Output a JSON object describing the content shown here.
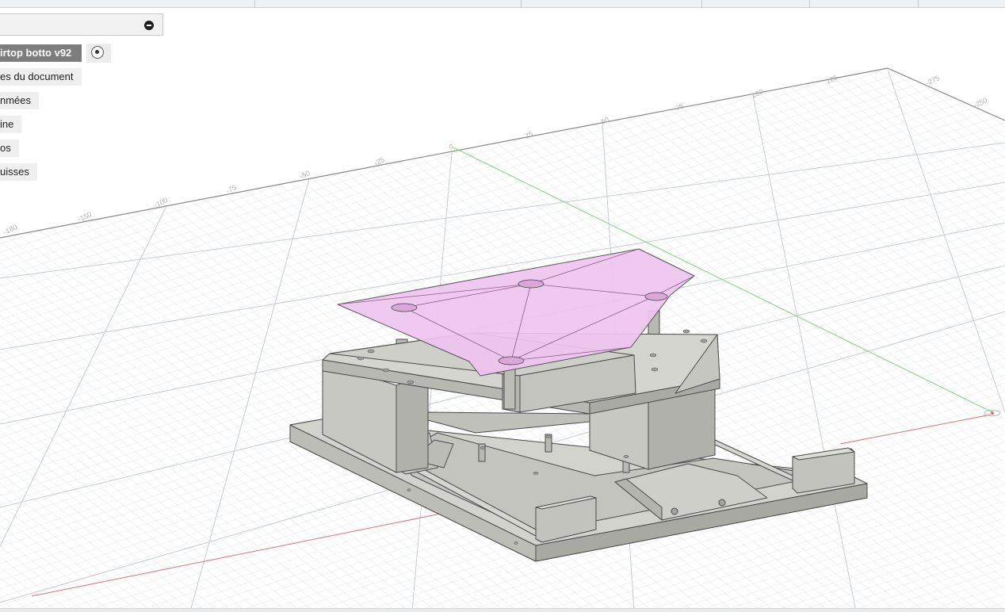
{
  "browser": {
    "root_label": "irtop botto v92",
    "items": [
      {
        "label": "es du document"
      },
      {
        "label": "nmées"
      },
      {
        "label": "ine"
      },
      {
        "label": "os"
      },
      {
        "label": "uisses"
      }
    ]
  },
  "colors": {
    "x_axis": "#e07070",
    "y_axis": "#7cd67c",
    "grid": "#d9dde2",
    "part_gray": "#c9c9c4",
    "part_edge": "#4a4a4a",
    "cover_pink": "#efc4ef"
  },
  "icons": {
    "collapse": "minus-circle-icon",
    "active_component": "radio-active-icon",
    "origin": "origin-icon"
  }
}
